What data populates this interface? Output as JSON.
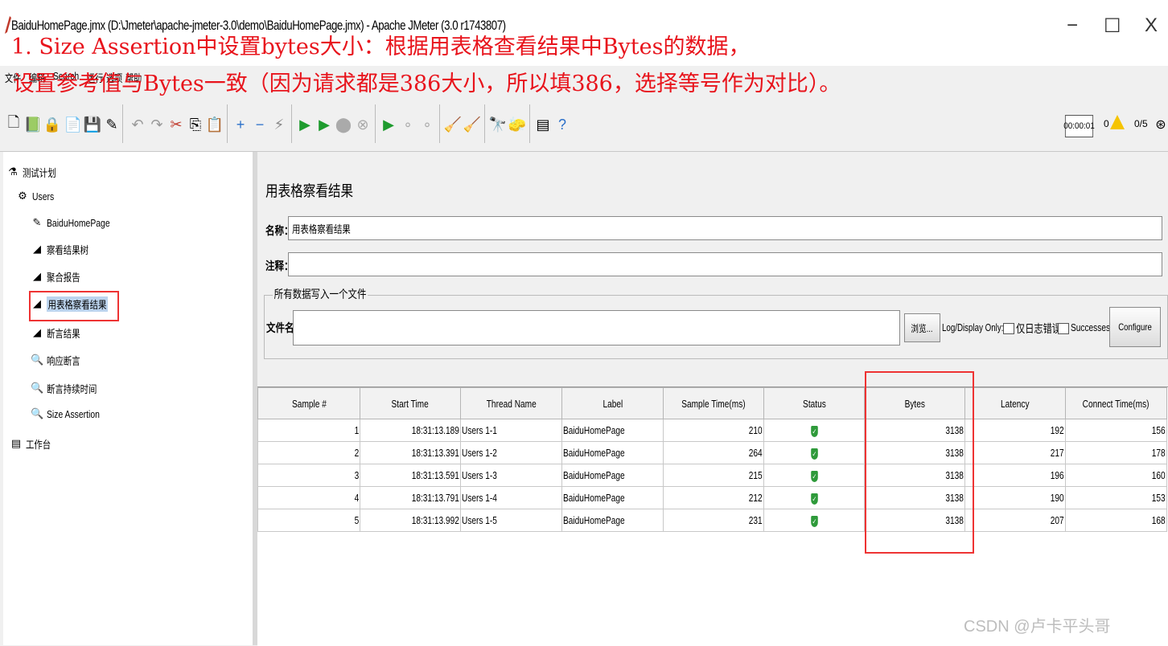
{
  "window": {
    "title": "BaiduHomePage.jmx (D:\\Jmeter\\apache-jmeter-3.0\\demo\\BaiduHomePage.jmx) - Apache JMeter (3.0 r1743807)",
    "minimize": "−",
    "maximize": "☐",
    "close": "X"
  },
  "annotation": {
    "line1": "1. Size Assertion中设置bytes大小：根据用表格查看结果中Bytes的数据，",
    "line2": "设置参考值与Bytes一致（因为请求都是386大小，所以填386，选择等号作为对比）。",
    "color": "#e8141c"
  },
  "menu": [
    "文件",
    "编辑",
    "Search",
    "运行",
    "选项",
    "帮助"
  ],
  "toolbar": {
    "timer": "00:00:01",
    "warnings": "0",
    "threads": "0/5"
  },
  "tree": {
    "nodes": [
      {
        "label": "测试计划",
        "icon": "test-plan-icon",
        "glyph": "⚗"
      },
      {
        "label": "Users",
        "icon": "thread-group-icon",
        "glyph": "⚙"
      },
      {
        "label": "BaiduHomePage",
        "icon": "http-sampler-icon",
        "glyph": "✎"
      },
      {
        "label": "察看结果树",
        "icon": "listener-icon",
        "glyph": "◢"
      },
      {
        "label": "聚合报告",
        "icon": "listener-icon",
        "glyph": "◢"
      },
      {
        "label": "用表格察看结果",
        "icon": "listener-icon",
        "glyph": "◢",
        "selected": true
      },
      {
        "label": "断言结果",
        "icon": "listener-icon",
        "glyph": "◢"
      },
      {
        "label": "响应断言",
        "icon": "assertion-icon",
        "glyph": "🔍"
      },
      {
        "label": "断言持续时间",
        "icon": "assertion-icon",
        "glyph": "🔍"
      },
      {
        "label": "Size Assertion",
        "icon": "assertion-icon",
        "glyph": "🔍"
      },
      {
        "label": "工作台",
        "icon": "workbench-icon",
        "glyph": "▤"
      }
    ]
  },
  "panel": {
    "title": "用表格察看结果",
    "name_label": "名称：",
    "name_value": "用表格察看结果",
    "comment_label": "注释：",
    "comment_value": "",
    "fieldset_legend": "所有数据写入一个文件",
    "filename_label": "文件名",
    "filename_value": "",
    "browse_button": "浏览...",
    "log_display_label": "Log/Display Only:",
    "errors_label": "仅日志错误",
    "successes_label": "Successes",
    "configure_button": "Configure"
  },
  "table": {
    "columns": [
      "Sample #",
      "Start Time",
      "Thread Name",
      "Label",
      "Sample Time(ms)",
      "Status",
      "Bytes",
      "Latency",
      "Connect Time(ms)"
    ],
    "rows": [
      [
        "1",
        "18:31:13.189",
        "Users 1-1",
        "BaiduHomePage",
        "210",
        "ok",
        "3138",
        "192",
        "156"
      ],
      [
        "2",
        "18:31:13.391",
        "Users 1-2",
        "BaiduHomePage",
        "264",
        "ok",
        "3138",
        "217",
        "178"
      ],
      [
        "3",
        "18:31:13.591",
        "Users 1-3",
        "BaiduHomePage",
        "215",
        "ok",
        "3138",
        "196",
        "160"
      ],
      [
        "4",
        "18:31:13.791",
        "Users 1-4",
        "BaiduHomePage",
        "212",
        "ok",
        "3138",
        "190",
        "153"
      ],
      [
        "5",
        "18:31:13.992",
        "Users 1-5",
        "BaiduHomePage",
        "231",
        "ok",
        "3138",
        "207",
        "168"
      ]
    ]
  },
  "watermark": "CSDN @卢卡平头哥"
}
